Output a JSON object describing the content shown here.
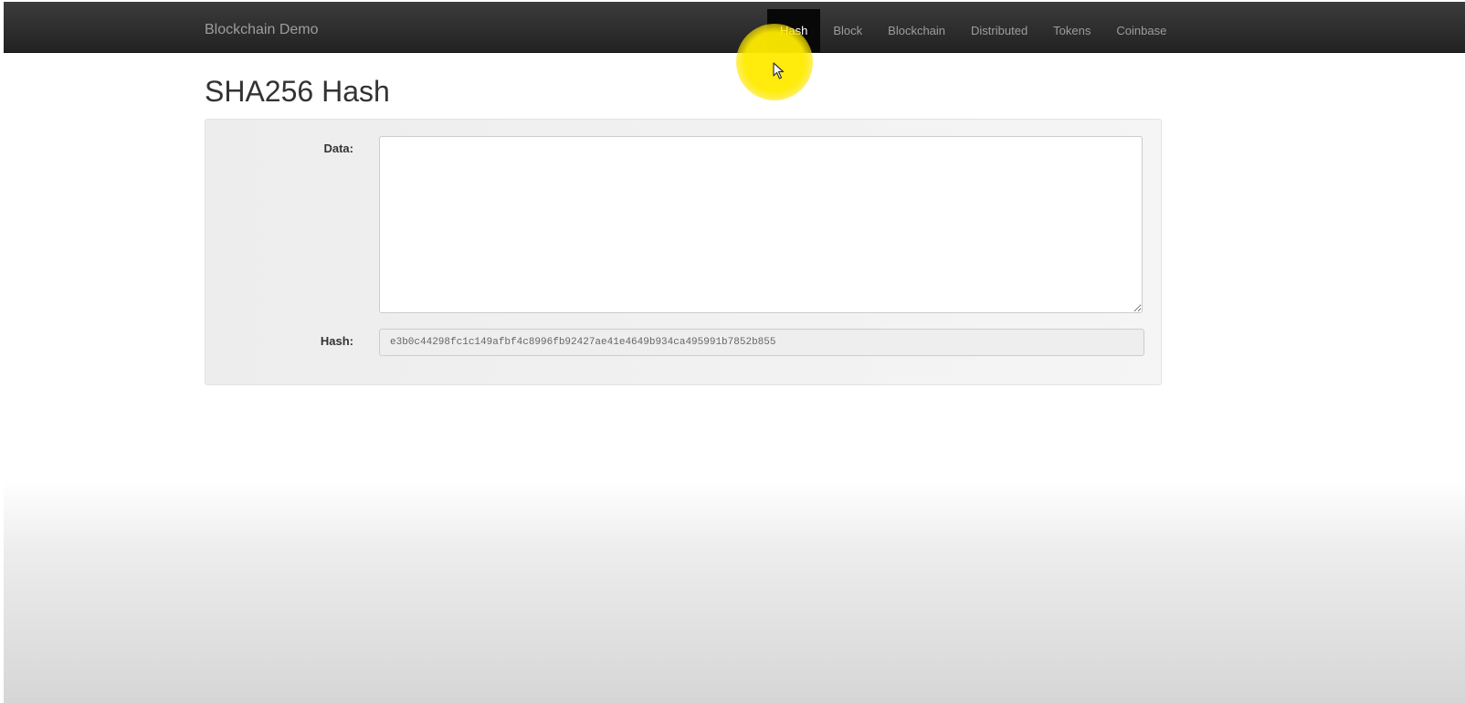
{
  "navbar": {
    "brand": "Blockchain Demo",
    "items": [
      {
        "label": "Hash",
        "active": true
      },
      {
        "label": "Block",
        "active": false
      },
      {
        "label": "Blockchain",
        "active": false
      },
      {
        "label": "Distributed",
        "active": false
      },
      {
        "label": "Tokens",
        "active": false
      },
      {
        "label": "Coinbase",
        "active": false
      }
    ]
  },
  "page": {
    "title": "SHA256 Hash"
  },
  "form": {
    "data_label": "Data:",
    "data_value": "",
    "hash_label": "Hash:",
    "hash_value": "e3b0c44298fc1c149afbf4c8996fb92427ae41e4649b934ca495991b7852b855"
  },
  "colors": {
    "navbar_bg": "#222222",
    "active_tab_bg": "#080808",
    "cursor_highlight": "#ffeb00"
  },
  "icons": {
    "cursor": "mouse-pointer-icon"
  }
}
